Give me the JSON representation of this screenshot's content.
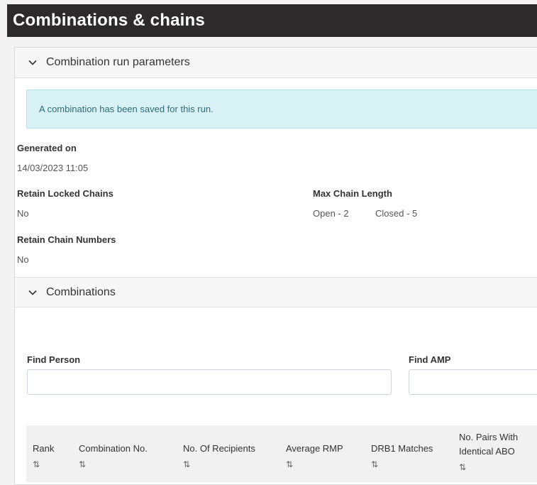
{
  "page": {
    "title": "Combinations & chains"
  },
  "params": {
    "title": "Combination run parameters",
    "alert": "A combination has been saved for this run.",
    "generated_on_label": "Generated on",
    "generated_on_value": "14/03/2023 11:05",
    "retain_locked_label": "Retain Locked Chains",
    "retain_locked_value": "No",
    "max_chain_label": "Max Chain Length",
    "max_chain_open": "Open - 2",
    "max_chain_closed": "Closed - 5",
    "retain_numbers_label": "Retain Chain Numbers",
    "retain_numbers_value": "No"
  },
  "combinations": {
    "title": "Combinations",
    "find_person_label": "Find Person",
    "find_person_value": "",
    "find_amp_label": "Find AMP",
    "find_amp_value": "",
    "sort_icon": "⇅",
    "columns": [
      {
        "line1": "Rank",
        "line2": ""
      },
      {
        "line1": "Combination No.",
        "line2": ""
      },
      {
        "line1": "No. Of Recipients",
        "line2": ""
      },
      {
        "line1": "Average RMP",
        "line2": ""
      },
      {
        "line1": "DRB1 Matches",
        "line2": ""
      },
      {
        "line1": "No. Pairs With",
        "line2": "Identical ABO"
      }
    ]
  },
  "icons": {
    "section_toggle": "chevron-down-icon",
    "sort": "sort-icon"
  },
  "colors": {
    "header_bg": "#2e2a2b",
    "alert_bg": "#d8f1f5",
    "alert_text": "#2f6c78"
  }
}
